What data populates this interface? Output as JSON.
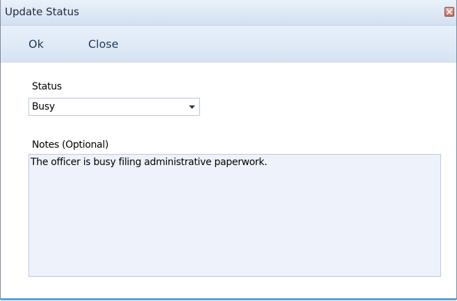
{
  "window": {
    "title": "Update Status"
  },
  "toolbar": {
    "ok_label": "Ok",
    "close_label": "Close"
  },
  "form": {
    "status_label": "Status",
    "status_value": "Busy",
    "notes_label": "Notes (Optional)",
    "notes_value": "The officer is busy filing administrative paperwork."
  },
  "icons": {
    "close": "close-icon",
    "dropdown": "chevron-down-icon"
  },
  "colors": {
    "titlebar": "#dde8f5",
    "toolbar": "#dfe9f6",
    "notes_bg": "#eef3fb",
    "close_button": "#c46d5e",
    "accent_bottom": "#5a9fd6"
  }
}
